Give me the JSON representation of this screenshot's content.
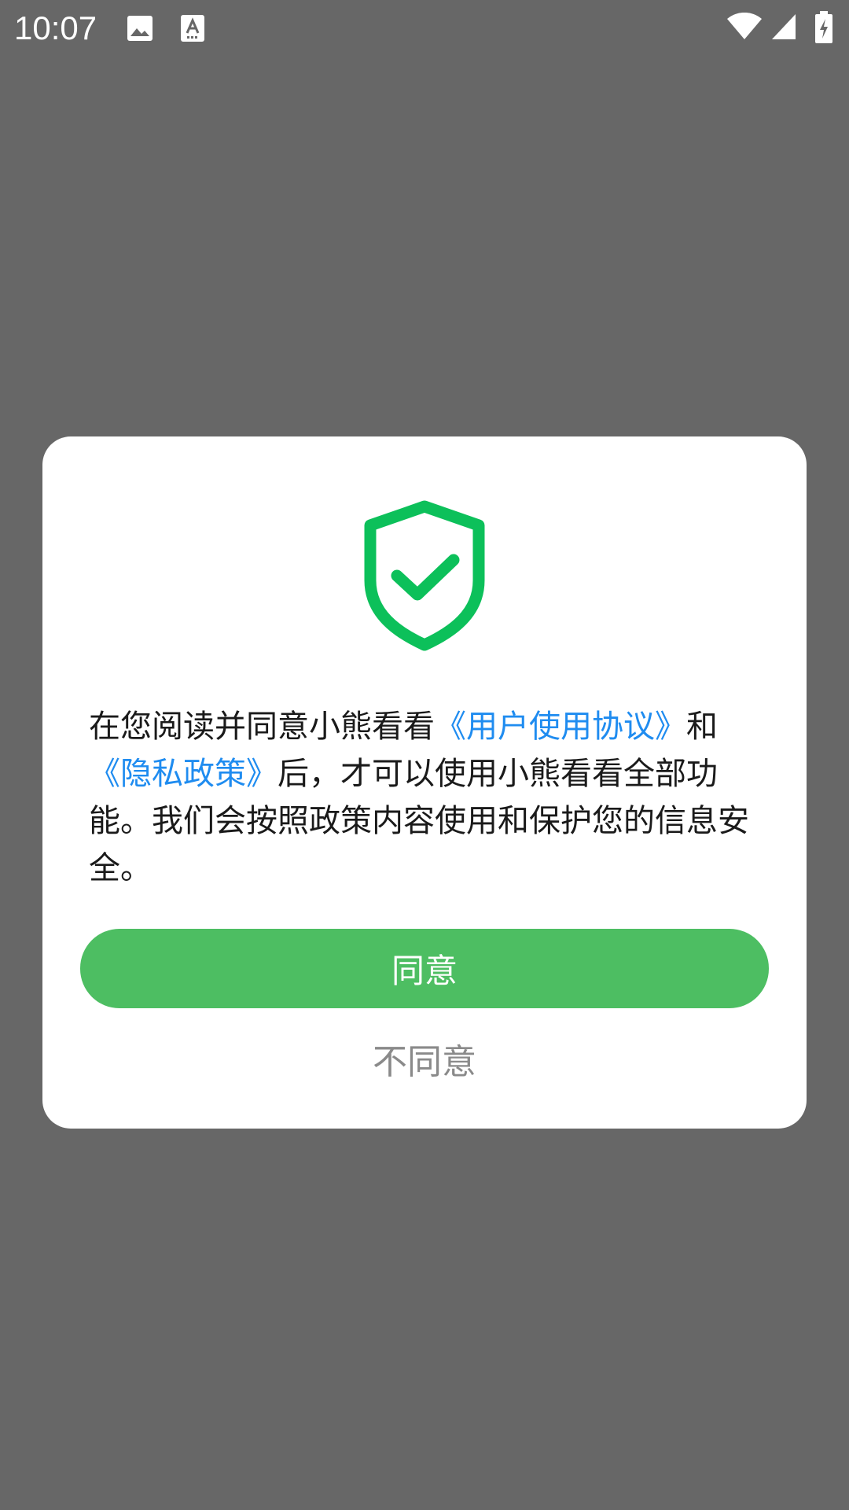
{
  "status_bar": {
    "time": "10:07",
    "icons": [
      "image-icon",
      "text-a-icon",
      "wifi-icon",
      "signal-icon",
      "battery-charging-icon"
    ]
  },
  "dialog": {
    "icon": "shield-check-icon",
    "message": {
      "part1": "在您阅读并同意小熊看看",
      "link_user_agreement": "《用户使用协议》",
      "part2": "和",
      "link_privacy": "《隐私政策》",
      "part3": "后，才可以使用小熊看看全部功能。我们会按照政策内容使用和保护您的信息安全。"
    },
    "agree_label": "同意",
    "disagree_label": "不同意"
  },
  "colors": {
    "overlay": "#676767",
    "accent_green": "#4dbe62",
    "shield_green": "#0cc05a",
    "link_blue": "#1f8cf0",
    "disagree_gray": "#8a8a8a"
  }
}
